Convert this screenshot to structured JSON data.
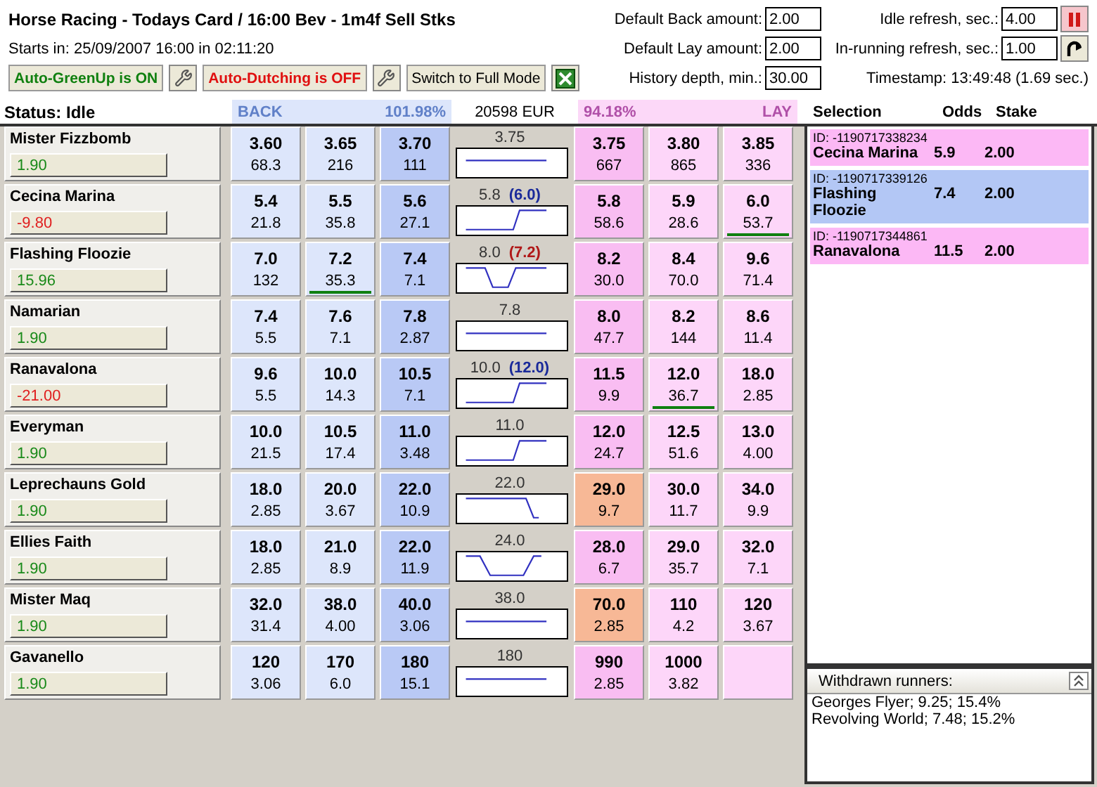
{
  "window": {
    "title": "Horse Racing - Todays Card / 16:00 Bev - 1m4f Sell Stks"
  },
  "starts": "Starts in: 25/09/2007 16:00 in 02:11:20",
  "toggles": [
    {
      "label": "Auto-GreenUp is ON",
      "on": true
    },
    {
      "label": "Auto-Dutching is OFF",
      "on": false
    }
  ],
  "mode_button": "Switch to Full Mode",
  "settings": [
    {
      "label": "Default Back amount:",
      "value": "2.00"
    },
    {
      "label": "Default Lay amount:",
      "value": "2.00"
    },
    {
      "label": "History depth, min.:",
      "value": "30.00"
    },
    {
      "label": "Idle refresh, sec.:",
      "value": "4.00"
    },
    {
      "label": "In-running refresh, sec.:",
      "value": "1.00"
    }
  ],
  "timestamp": "Timestamp: 13:49:48 (1.69 sec.)",
  "status": "Status: Idle",
  "back_header": {
    "label": "BACK",
    "percent": "101.98%"
  },
  "matched": "20598 EUR",
  "lay_header": {
    "label": "LAY",
    "percent": "94.18%"
  },
  "runners": [
    {
      "name": "Mister Fizzbomb",
      "pl": "1.90",
      "color": "#1a8a1a",
      "back": [
        {
          "price": "3.60",
          "amount": "68.3",
          "marked": false
        },
        {
          "price": "3.65",
          "amount": "216",
          "marked": false
        },
        {
          "price": "3.70",
          "amount": "111",
          "marked": false
        }
      ],
      "last": "3.75",
      "kind": "flat",
      "lay": [
        {
          "price": "3.75",
          "amount": "667",
          "marked": false,
          "highlighted": false
        },
        {
          "price": "3.80",
          "amount": "865",
          "marked": false,
          "highlighted": false
        },
        {
          "price": "3.85",
          "amount": "336",
          "marked": false,
          "highlighted": false
        }
      ]
    },
    {
      "name": "Cecina Marina",
      "pl": "-9.80",
      "color": "#e02020",
      "back": [
        {
          "price": "5.4",
          "amount": "21.8",
          "marked": false
        },
        {
          "price": "5.5",
          "amount": "35.8",
          "marked": false
        },
        {
          "price": "5.6",
          "amount": "27.1",
          "marked": false
        }
      ],
      "last": "5.8",
      "target": {
        "text": "(6.0)",
        "color": "#1a2a9a"
      },
      "kind": "rise",
      "lay": [
        {
          "price": "5.8",
          "amount": "58.6",
          "marked": false,
          "highlighted": false
        },
        {
          "price": "5.9",
          "amount": "28.6",
          "marked": false,
          "highlighted": false
        },
        {
          "price": "6.0",
          "amount": "53.7",
          "marked": true,
          "highlighted": false
        }
      ]
    },
    {
      "name": "Flashing Floozie",
      "pl": "15.96",
      "color": "#1a8a1a",
      "back": [
        {
          "price": "7.0",
          "amount": "132",
          "marked": false
        },
        {
          "price": "7.2",
          "amount": "35.3",
          "marked": true
        },
        {
          "price": "7.4",
          "amount": "7.1",
          "marked": false
        }
      ],
      "last": "8.0",
      "target": {
        "text": "(7.2)",
        "color": "#b01818"
      },
      "kind": "dip",
      "lay": [
        {
          "price": "8.2",
          "amount": "30.0",
          "marked": false,
          "highlighted": false
        },
        {
          "price": "8.4",
          "amount": "70.0",
          "marked": false,
          "highlighted": false
        },
        {
          "price": "9.6",
          "amount": "71.4",
          "marked": false,
          "highlighted": false
        }
      ]
    },
    {
      "name": "Namarian",
      "pl": "1.90",
      "color": "#1a8a1a",
      "back": [
        {
          "price": "7.4",
          "amount": "5.5",
          "marked": false
        },
        {
          "price": "7.6",
          "amount": "7.1",
          "marked": false
        },
        {
          "price": "7.8",
          "amount": "2.87",
          "marked": false
        }
      ],
      "last": "7.8",
      "kind": "flat",
      "lay": [
        {
          "price": "8.0",
          "amount": "47.7",
          "marked": false,
          "highlighted": false
        },
        {
          "price": "8.2",
          "amount": "144",
          "marked": false,
          "highlighted": false
        },
        {
          "price": "8.6",
          "amount": "11.4",
          "marked": false,
          "highlighted": false
        }
      ]
    },
    {
      "name": "Ranavalona",
      "pl": "-21.00",
      "color": "#e02020",
      "back": [
        {
          "price": "9.6",
          "amount": "5.5",
          "marked": false
        },
        {
          "price": "10.0",
          "amount": "14.3",
          "marked": false
        },
        {
          "price": "10.5",
          "amount": "7.1",
          "marked": false
        }
      ],
      "last": "10.0",
      "target": {
        "text": "(12.0)",
        "color": "#1a2a9a"
      },
      "kind": "rise",
      "lay": [
        {
          "price": "11.5",
          "amount": "9.9",
          "marked": false,
          "highlighted": false
        },
        {
          "price": "12.0",
          "amount": "36.7",
          "marked": true,
          "highlighted": false
        },
        {
          "price": "18.0",
          "amount": "2.85",
          "marked": false,
          "highlighted": false
        }
      ]
    },
    {
      "name": "Everyman",
      "pl": "1.90",
      "color": "#1a8a1a",
      "back": [
        {
          "price": "10.0",
          "amount": "21.5",
          "marked": false
        },
        {
          "price": "10.5",
          "amount": "17.4",
          "marked": false
        },
        {
          "price": "11.0",
          "amount": "3.48",
          "marked": false
        }
      ],
      "last": "11.0",
      "kind": "rise",
      "lay": [
        {
          "price": "12.0",
          "amount": "24.7",
          "marked": false,
          "highlighted": false
        },
        {
          "price": "12.5",
          "amount": "51.6",
          "marked": false,
          "highlighted": false
        },
        {
          "price": "13.0",
          "amount": "4.00",
          "marked": false,
          "highlighted": false
        }
      ]
    },
    {
      "name": "Leprechauns Gold",
      "pl": "1.90",
      "color": "#1a8a1a",
      "back": [
        {
          "price": "18.0",
          "amount": "2.85",
          "marked": false
        },
        {
          "price": "20.0",
          "amount": "3.67",
          "marked": false
        },
        {
          "price": "22.0",
          "amount": "10.9",
          "marked": false
        }
      ],
      "last": "22.0",
      "kind": "fall",
      "lay": [
        {
          "price": "29.0",
          "amount": "9.7",
          "marked": false,
          "highlighted": true
        },
        {
          "price": "30.0",
          "amount": "11.7",
          "marked": false,
          "highlighted": false
        },
        {
          "price": "34.0",
          "amount": "9.9",
          "marked": false,
          "highlighted": false
        }
      ]
    },
    {
      "name": "Ellies Faith",
      "pl": "1.90",
      "color": "#1a8a1a",
      "back": [
        {
          "price": "18.0",
          "amount": "2.85",
          "marked": false
        },
        {
          "price": "21.0",
          "amount": "8.9",
          "marked": false
        },
        {
          "price": "22.0",
          "amount": "11.9",
          "marked": false
        }
      ],
      "last": "24.0",
      "kind": "wide-dip",
      "lay": [
        {
          "price": "28.0",
          "amount": "6.7",
          "marked": false,
          "highlighted": false
        },
        {
          "price": "29.0",
          "amount": "35.7",
          "marked": false,
          "highlighted": false
        },
        {
          "price": "32.0",
          "amount": "7.1",
          "marked": false,
          "highlighted": false
        }
      ]
    },
    {
      "name": "Mister Maq",
      "pl": "1.90",
      "color": "#1a8a1a",
      "back": [
        {
          "price": "32.0",
          "amount": "31.4",
          "marked": false
        },
        {
          "price": "38.0",
          "amount": "4.00",
          "marked": false
        },
        {
          "price": "40.0",
          "amount": "3.06",
          "marked": false
        }
      ],
      "last": "38.0",
      "kind": "flat",
      "lay": [
        {
          "price": "70.0",
          "amount": "2.85",
          "marked": false,
          "highlighted": true
        },
        {
          "price": "110",
          "amount": "4.2",
          "marked": false,
          "highlighted": false
        },
        {
          "price": "120",
          "amount": "3.67",
          "marked": false,
          "highlighted": false
        }
      ]
    },
    {
      "name": "Gavanello",
      "pl": "1.90",
      "color": "#1a8a1a",
      "back": [
        {
          "price": "120",
          "amount": "3.06",
          "marked": false
        },
        {
          "price": "170",
          "amount": "6.0",
          "marked": false
        },
        {
          "price": "180",
          "amount": "15.1",
          "marked": false
        }
      ],
      "last": "180",
      "kind": "flat",
      "lay": [
        {
          "price": "990",
          "amount": "2.85",
          "marked": false,
          "highlighted": false
        },
        {
          "price": "1000",
          "amount": "3.82",
          "marked": false,
          "highlighted": false
        }
      ]
    }
  ],
  "bets_header": {
    "selection": "Selection",
    "odds": "Odds",
    "stake": "Stake"
  },
  "bets": [
    {
      "id": "ID: -1190717338234",
      "selection": "Cecina Marina",
      "odds": "5.9",
      "stake": "2.00",
      "kind": "lay"
    },
    {
      "id": "ID: -1190717339126",
      "selection": "Flashing Floozie",
      "odds": "7.4",
      "stake": "2.00",
      "kind": "back"
    },
    {
      "id": "ID: -1190717344861",
      "selection": "Ranavalona",
      "odds": "11.5",
      "stake": "2.00",
      "kind": "lay"
    }
  ],
  "withdrawn": {
    "title": "Withdrawn runners:",
    "items": [
      "Georges Flyer; 9.25; 15.4%",
      "Revolving World; 7.48; 15.2%"
    ]
  }
}
